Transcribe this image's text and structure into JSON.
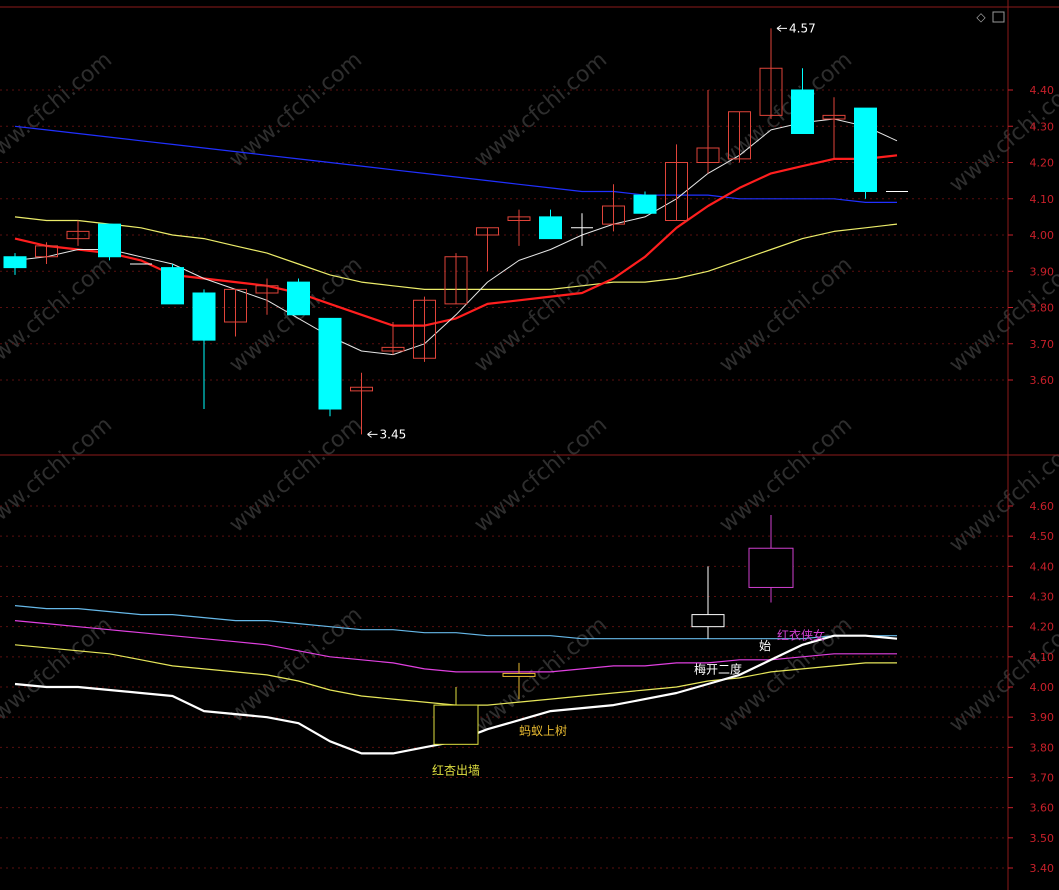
{
  "colors": {
    "background": "#000000",
    "frame": "#8b1a1a",
    "grid": "#5a0f0f",
    "axis_label": "#c8202a",
    "up": "#e0443a",
    "down": "#00ffff",
    "ma_fast": "#e6e6e6",
    "ma_mid": "#ff1e1e",
    "ma_slow": "#ecec6a",
    "ma_long": "#2030ff",
    "env_top": "#66b8e8",
    "env_mid": "#e040e0",
    "env_low": "#e6e65a",
    "env_base": "#ffffff",
    "pattern_yellow": "#e0e040",
    "pattern_orange": "#e6b830",
    "pattern_white": "#ffffff",
    "pattern_magenta": "#d040d0",
    "note_white": "#ffffff",
    "note_magenta": "#d048d8",
    "watermark": "#2e2e2e"
  },
  "toolbar": {
    "diamond_label": "◇"
  },
  "watermark": "www.cfchi.com",
  "chart_data": [
    {
      "type": "candlestick",
      "panel": "upper",
      "ylim": [
        3.45,
        4.6
      ],
      "yticks": [
        "4.40",
        "4.30",
        "4.20",
        "4.10",
        "4.00",
        "3.90",
        "3.80",
        "3.70",
        "3.60"
      ],
      "ohlc": [
        [
          3.94,
          3.95,
          3.89,
          3.91
        ],
        [
          3.94,
          3.98,
          3.92,
          3.97
        ],
        [
          3.99,
          4.04,
          3.97,
          4.01
        ],
        [
          4.03,
          4.03,
          3.93,
          3.94
        ],
        [
          3.92,
          3.92,
          3.92,
          3.92
        ],
        [
          3.91,
          3.92,
          3.81,
          3.81
        ],
        [
          3.84,
          3.85,
          3.52,
          3.71
        ],
        [
          3.76,
          3.85,
          3.72,
          3.85
        ],
        [
          3.84,
          3.88,
          3.78,
          3.86
        ],
        [
          3.87,
          3.88,
          3.78,
          3.78
        ],
        [
          3.77,
          3.77,
          3.5,
          3.52
        ],
        [
          3.57,
          3.62,
          3.45,
          3.58
        ],
        [
          3.68,
          3.76,
          3.67,
          3.69
        ],
        [
          3.66,
          3.83,
          3.65,
          3.82
        ],
        [
          3.81,
          3.95,
          3.81,
          3.94
        ],
        [
          4.0,
          4.02,
          3.9,
          4.02
        ],
        [
          4.04,
          4.07,
          3.97,
          4.05
        ],
        [
          4.05,
          4.07,
          3.99,
          3.99
        ],
        [
          4.02,
          4.06,
          3.97,
          4.02
        ],
        [
          4.03,
          4.14,
          4.01,
          4.08
        ],
        [
          4.11,
          4.12,
          4.06,
          4.06
        ],
        [
          4.04,
          4.25,
          4.04,
          4.2
        ],
        [
          4.2,
          4.4,
          4.17,
          4.24
        ],
        [
          4.21,
          4.34,
          4.2,
          4.34
        ],
        [
          4.33,
          4.57,
          4.32,
          4.46
        ],
        [
          4.4,
          4.46,
          4.28,
          4.28
        ],
        [
          4.32,
          4.38,
          4.21,
          4.33
        ],
        [
          4.35,
          4.35,
          4.1,
          4.12
        ],
        [
          4.12,
          4.12,
          4.12,
          4.12
        ]
      ],
      "ma_fast": [
        3.93,
        3.94,
        3.96,
        3.96,
        3.94,
        3.92,
        3.88,
        3.85,
        3.82,
        3.77,
        3.72,
        3.68,
        3.67,
        3.7,
        3.78,
        3.87,
        3.93,
        3.96,
        4.0,
        4.03,
        4.05,
        4.1,
        4.17,
        4.22,
        4.29,
        4.31,
        4.32,
        4.3,
        4.26
      ],
      "ma_mid": [
        3.99,
        3.97,
        3.96,
        3.95,
        3.93,
        3.89,
        3.88,
        3.87,
        3.86,
        3.84,
        3.81,
        3.78,
        3.75,
        3.75,
        3.77,
        3.81,
        3.82,
        3.83,
        3.84,
        3.88,
        3.94,
        4.02,
        4.08,
        4.13,
        4.17,
        4.19,
        4.21,
        4.21,
        4.22
      ],
      "ma_slow": [
        4.05,
        4.04,
        4.04,
        4.03,
        4.02,
        4.0,
        3.99,
        3.97,
        3.95,
        3.92,
        3.89,
        3.87,
        3.86,
        3.85,
        3.85,
        3.85,
        3.85,
        3.85,
        3.86,
        3.87,
        3.87,
        3.88,
        3.9,
        3.93,
        3.96,
        3.99,
        4.01,
        4.02,
        4.03
      ],
      "ma_long": [
        4.3,
        4.29,
        4.28,
        4.27,
        4.26,
        4.25,
        4.24,
        4.23,
        4.22,
        4.21,
        4.2,
        4.19,
        4.18,
        4.17,
        4.16,
        4.15,
        4.14,
        4.13,
        4.12,
        4.12,
        4.11,
        4.11,
        4.11,
        4.1,
        4.1,
        4.1,
        4.1,
        4.09,
        4.09
      ],
      "annotations": [
        {
          "text": "4.57",
          "bar": 24,
          "value": 4.57
        },
        {
          "text": "3.45",
          "bar": 11,
          "value": 3.45
        }
      ]
    },
    {
      "type": "line",
      "panel": "lower",
      "ylim": [
        3.35,
        4.72
      ],
      "yticks": [
        "4.60",
        "4.50",
        "4.40",
        "4.30",
        "4.20",
        "4.10",
        "4.00",
        "3.90",
        "3.80",
        "3.70",
        "3.60",
        "3.50",
        "3.40"
      ],
      "env_top": [
        4.27,
        4.26,
        4.26,
        4.25,
        4.24,
        4.24,
        4.23,
        4.22,
        4.22,
        4.21,
        4.2,
        4.19,
        4.19,
        4.18,
        4.18,
        4.17,
        4.17,
        4.17,
        4.16,
        4.16,
        4.16,
        4.16,
        4.16,
        4.16,
        4.16,
        4.16,
        4.17,
        4.17,
        4.17
      ],
      "env_mid": [
        4.22,
        4.21,
        4.2,
        4.19,
        4.18,
        4.17,
        4.16,
        4.15,
        4.14,
        4.12,
        4.1,
        4.09,
        4.08,
        4.06,
        4.05,
        4.05,
        4.05,
        4.05,
        4.06,
        4.07,
        4.07,
        4.08,
        4.08,
        4.09,
        4.09,
        4.1,
        4.11,
        4.11,
        4.11
      ],
      "env_low": [
        4.14,
        4.13,
        4.12,
        4.11,
        4.09,
        4.07,
        4.06,
        4.05,
        4.04,
        4.02,
        3.99,
        3.97,
        3.96,
        3.95,
        3.94,
        3.94,
        3.95,
        3.96,
        3.97,
        3.98,
        3.99,
        4.0,
        4.02,
        4.03,
        4.05,
        4.06,
        4.07,
        4.08,
        4.08
      ],
      "env_base": [
        4.01,
        4.0,
        4.0,
        3.99,
        3.98,
        3.97,
        3.92,
        3.91,
        3.9,
        3.88,
        3.82,
        3.78,
        3.78,
        3.8,
        3.82,
        3.86,
        3.89,
        3.92,
        3.93,
        3.94,
        3.96,
        3.98,
        4.01,
        4.04,
        4.09,
        4.14,
        4.17,
        4.17,
        4.16
      ],
      "patterns": [
        {
          "label": "红杏出墙",
          "bar": 14,
          "open": 3.94,
          "high": 4.0,
          "low": 3.81,
          "close": 3.81,
          "color_key": "pattern_yellow"
        },
        {
          "label": "蚂蚁上树",
          "bar": 16,
          "open": 4.04,
          "high": 4.08,
          "low": 3.96,
          "close": 4.04,
          "color_key": "pattern_orange"
        },
        {
          "label": "梅开二度",
          "bar": 22,
          "open": 4.24,
          "high": 4.4,
          "low": 4.16,
          "close": 4.2,
          "color_key": "pattern_white"
        },
        {
          "label": "红衣侠女",
          "bar": 24,
          "open": 4.46,
          "high": 4.57,
          "low": 4.28,
          "close": 4.33,
          "color_key": "pattern_magenta"
        }
      ],
      "notes": [
        {
          "text": "始",
          "bar": 24,
          "value": 4.14,
          "color_key": "note_white"
        }
      ]
    }
  ]
}
